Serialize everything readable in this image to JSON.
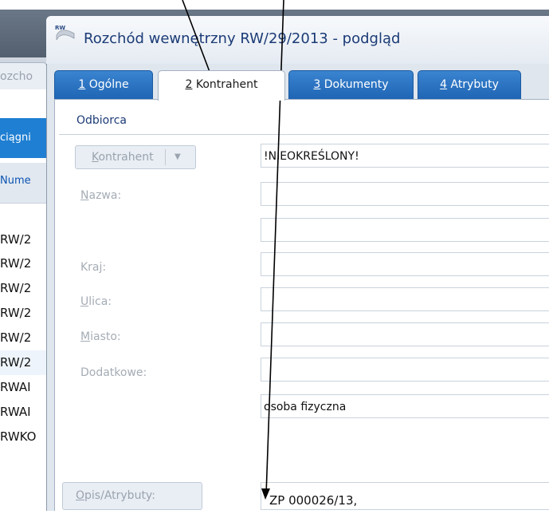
{
  "background_window": {
    "tab_fragment": "ozcho",
    "header_fragment": "ciągni",
    "column_fragment": "Nume",
    "rows": [
      "RW/2",
      "RW/2",
      "RW/2",
      "RW/2",
      "RW/2",
      "RW/2",
      "RWAI",
      "RWAI",
      "RWKO"
    ]
  },
  "dialog": {
    "title": "Rozchód wewnętrzny RW/29/2013 - podgląd",
    "icon_label": "RW",
    "tabs": [
      {
        "key": "1",
        "label": " Ogólne",
        "active": false
      },
      {
        "key": "2",
        "label": " Kontrahent",
        "active": true
      },
      {
        "key": "3",
        "label": " Dokumenty",
        "active": false
      },
      {
        "key": "4",
        "label": " Atrybuty",
        "active": false
      }
    ],
    "group_title": "Odbiorca",
    "kontrahent_button": {
      "hotkey": "K",
      "rest": "ontrahent"
    },
    "fields": {
      "kontrahent_value": "!NIEOKREŚLONY!",
      "nazwa_label_hotkey": "N",
      "nazwa_label_rest": "azwa:",
      "nazwa_value": "",
      "nazwa2_value": "",
      "kraj_label": "Kraj:",
      "kraj_value": "",
      "ulica_label_hotkey": "U",
      "ulica_label_rest": "lica:",
      "ulica_value": "",
      "miasto_label_hotkey": "M",
      "miasto_label_rest": "iasto:",
      "miasto_value": "",
      "dodatkowe_label": "Dodatkowe:",
      "dodatkowe_value": "",
      "status_value": "osoba fizyczna"
    },
    "opis_button": {
      "hotkey": "O",
      "rest": "pis/Atrybuty:"
    },
    "opis_value": "ZP 000026/13,"
  },
  "colors": {
    "active_tab": "#ffffff",
    "inactive_tab": "#1e64b4",
    "title_text": "#1b3b76",
    "disabled_text": "#a5acb5",
    "selection_blue": "#1f7fd2"
  }
}
